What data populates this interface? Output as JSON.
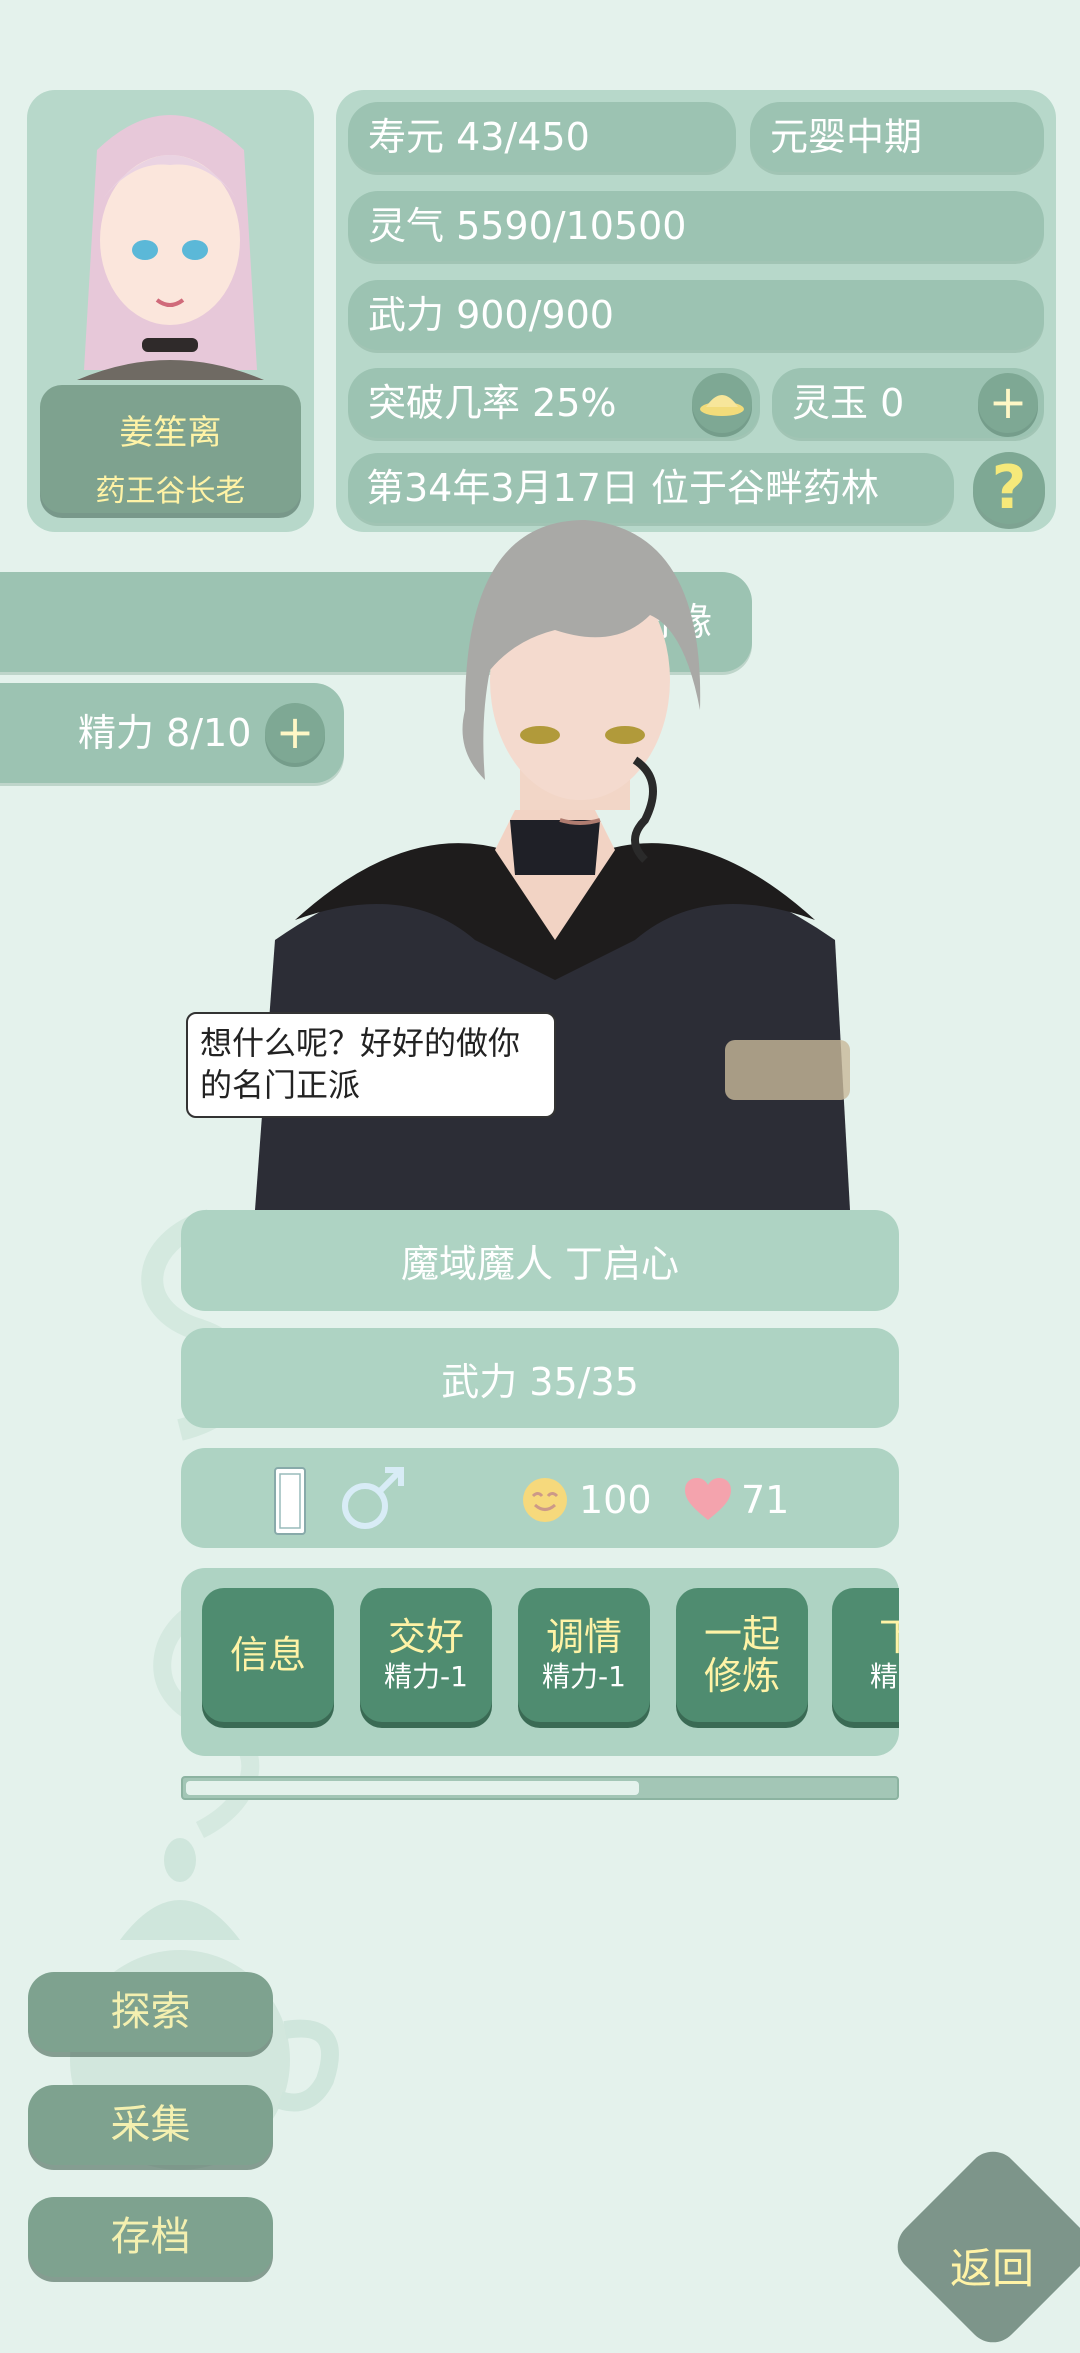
{
  "player": {
    "name": "姜笙离",
    "title": "药王谷长老"
  },
  "stats": {
    "lifespan": "寿元 43/450",
    "realm": "元婴中期",
    "spirit_qi": "灵气 5590/10500",
    "force": "武力 900/900",
    "breakthrough": "突破几率 25%",
    "jade": "灵玉 0",
    "date_location": "第34年3月17日 位于谷畔药林"
  },
  "side": {
    "fortune_label": "奇缘",
    "energy": "精力 8/10"
  },
  "npc": {
    "speech": "想什么呢？好好的做你的名门正派",
    "name_line": "魔域魔人 丁启心",
    "force": "武力 35/35",
    "mood_value": "100",
    "affection_value": "71",
    "action_scroll_fraction": 0.64
  },
  "actions": [
    {
      "label": "信息",
      "sub": ""
    },
    {
      "label": "交好",
      "sub": "精力-1"
    },
    {
      "label": "调情",
      "sub": "精力-1"
    },
    {
      "label": "一起修炼",
      "sub": ""
    },
    {
      "label": "下",
      "sub": "精力"
    }
  ],
  "menu": {
    "explore": "探索",
    "gather": "采集",
    "save": "存档"
  },
  "back_label": "返回",
  "help_glyph": "?",
  "plus_glyph": "+",
  "icons": {
    "gender": "male-symbol-icon",
    "mood": "smiley-face-icon",
    "affection": "heart-icon",
    "card": "identity-card-icon",
    "breakthrough": "pill-dish-icon"
  },
  "colors": {
    "background": "#e4f2ec",
    "pill": "#9cc3b2",
    "action_button": "#4f8c70",
    "button_text": "#fff3a6"
  }
}
